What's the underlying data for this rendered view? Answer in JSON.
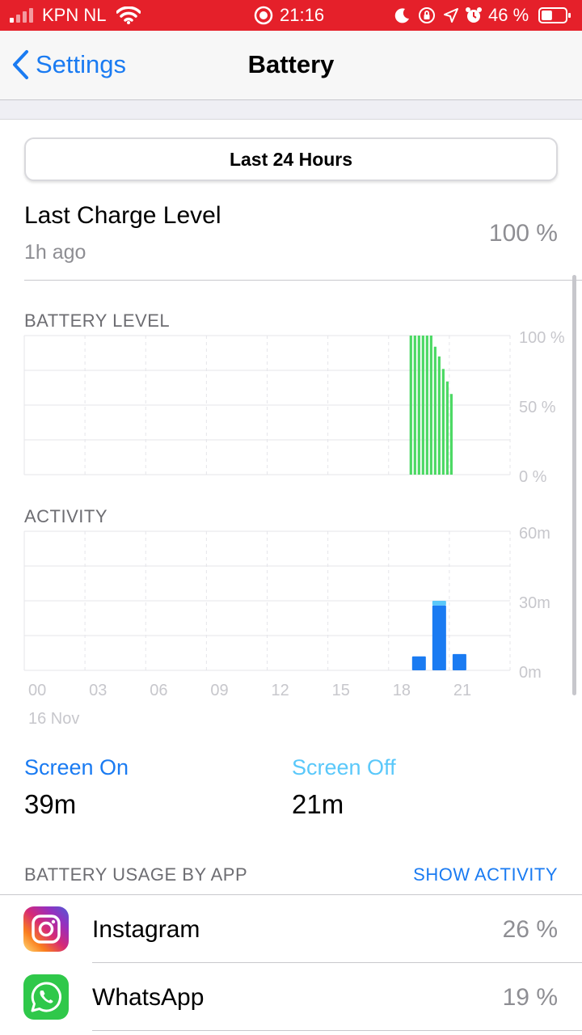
{
  "status_bar": {
    "carrier": "KPN NL",
    "time": "21:16",
    "battery_percent": "46 %",
    "battery_level": 0.46
  },
  "nav": {
    "back_label": "Settings",
    "title": "Battery"
  },
  "segment": {
    "selected": "Last 24 Hours"
  },
  "last_charge": {
    "title": "Last Charge Level",
    "subtitle": "1h ago",
    "value": "100 %"
  },
  "battery_level_chart": {
    "label": "BATTERY LEVEL",
    "y_tick_labels": [
      "100 %",
      "50 %",
      "0 %"
    ]
  },
  "activity_chart": {
    "label": "ACTIVITY",
    "y_tick_labels": [
      "60m",
      "30m",
      "0m"
    ],
    "x_tick_labels": [
      "00",
      "03",
      "06",
      "09",
      "12",
      "15",
      "18",
      "21"
    ],
    "date_label": "16 Nov"
  },
  "chart_data": [
    {
      "type": "bar",
      "title": "BATTERY LEVEL",
      "x_hours": [
        19.1,
        19.3,
        19.5,
        19.7,
        19.9,
        20.1,
        20.3,
        20.5,
        20.7,
        20.9,
        21.1
      ],
      "values": [
        100,
        100,
        100,
        100,
        100,
        100,
        92,
        85,
        76,
        67,
        58
      ],
      "ylim": [
        0,
        100
      ],
      "xlim": [
        0,
        24
      ],
      "x_ticks": [
        "00",
        "03",
        "06",
        "09",
        "12",
        "15",
        "18",
        "21"
      ],
      "y_ticks": [
        "0 %",
        "50 %",
        "100 %"
      ],
      "grid": true,
      "color": "#4cd964"
    },
    {
      "type": "bar",
      "title": "ACTIVITY",
      "categories": [
        "19",
        "20",
        "21"
      ],
      "series": [
        {
          "name": "Screen On",
          "values": [
            6,
            28,
            7
          ],
          "color": "#1a7bf2"
        },
        {
          "name": "Screen Off",
          "values": [
            0,
            2,
            0
          ],
          "color": "#5ac8fa"
        }
      ],
      "ylim": [
        0,
        60
      ],
      "xlim": [
        0,
        24
      ],
      "x_ticks": [
        "00",
        "03",
        "06",
        "09",
        "12",
        "15",
        "18",
        "21"
      ],
      "y_ticks": [
        "0m",
        "30m",
        "60m"
      ],
      "grid": true
    }
  ],
  "stats": {
    "screen_on_label": "Screen On",
    "screen_on_value": "39m",
    "screen_off_label": "Screen Off",
    "screen_off_value": "21m"
  },
  "usage": {
    "header": "BATTERY USAGE BY APP",
    "action": "SHOW ACTIVITY",
    "apps": [
      {
        "name": "Instagram",
        "percent": "26 %",
        "icon": "instagram-icon"
      },
      {
        "name": "WhatsApp",
        "percent": "19 %",
        "icon": "whatsapp-icon"
      }
    ]
  },
  "colors": {
    "accent": "#1a7bf2",
    "status_bar": "#e5202a",
    "battery_green": "#4cd964",
    "screen_off": "#5ac8fa"
  }
}
